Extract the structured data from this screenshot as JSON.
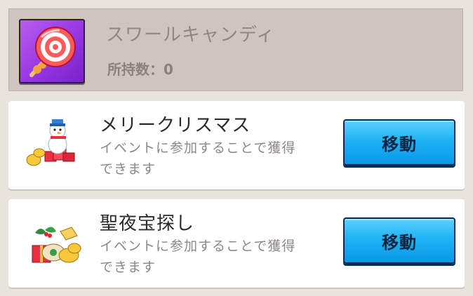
{
  "item": {
    "name": "スワールキャンディ",
    "count_label": "所持数：0",
    "icon": "swirl-candy-icon"
  },
  "sources": [
    {
      "title": "メリークリスマス",
      "desc_line1": "イベントに参加することで獲得",
      "desc_line2": "できます",
      "button_label": "移動",
      "icon": "christmas-snowman-icon"
    },
    {
      "title": "聖夜宝探し",
      "desc_line1": "イベントに参加することで獲得",
      "desc_line2": "できます",
      "button_label": "移動",
      "icon": "treasure-hunt-icon"
    }
  ],
  "colors": {
    "button": "#1fb3f5",
    "icon_bg": "#9333e0"
  }
}
